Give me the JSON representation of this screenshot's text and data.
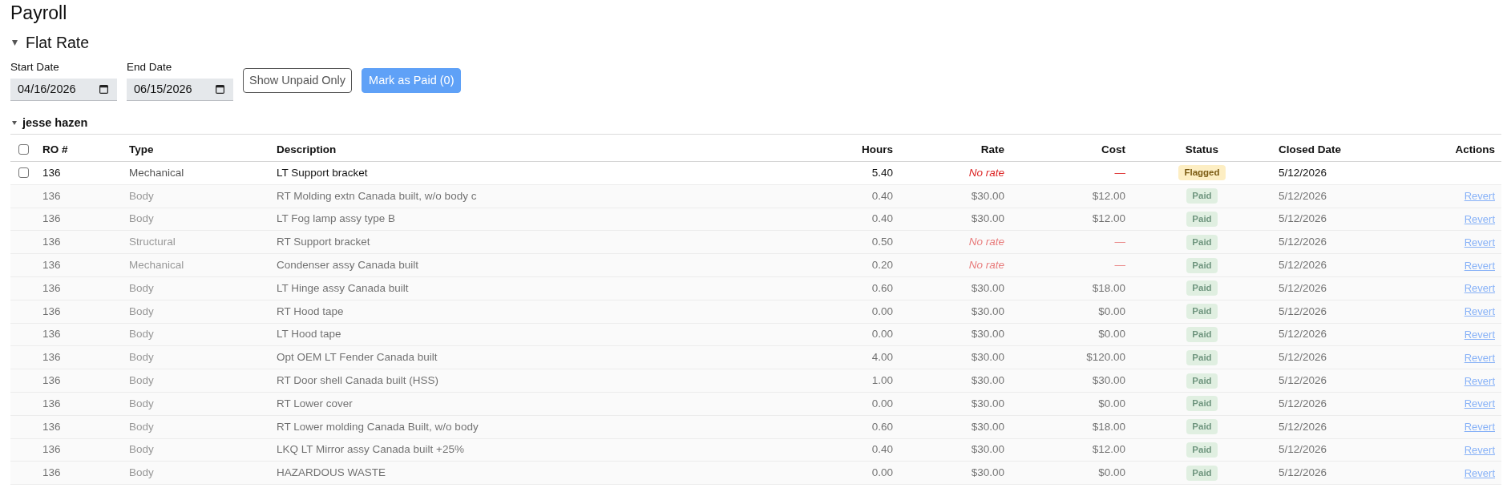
{
  "page": {
    "title": "Payroll"
  },
  "section": {
    "title": "Flat Rate",
    "expanded": true,
    "filters": [
      {
        "label": "Start Date",
        "value": "04/16/2026"
      },
      {
        "label": "End Date",
        "value": "06/15/2026"
      }
    ],
    "buttons": [
      {
        "label": "Show Unpaid Only",
        "kind": "outline"
      },
      {
        "label": "Mark as Paid (0)",
        "kind": "primary"
      }
    ],
    "groups": [
      {
        "name": "jesse hazen",
        "expanded": true,
        "table": {
          "select_all": {
            "checked": false
          },
          "columns": [
            "RO #",
            "Type",
            "Description",
            "Hours",
            "Rate",
            "Cost",
            "Status",
            "Closed Date",
            "Actions"
          ],
          "rows": [
            {
              "kind": "unpaid",
              "checked": false,
              "ro": "136",
              "type": "Mechanical",
              "description": "LT Support bracket",
              "hours": "5.40",
              "rate": "No rate",
              "rate_missing": true,
              "cost": "—",
              "status": {
                "label": "Flagged",
                "kind": "flagged"
              },
              "closed_date": "5/12/2026"
            },
            {
              "kind": "paid",
              "ro": "136",
              "type": "Body",
              "description": "RT Molding extn Canada built, w/o body c",
              "hours": "0.40",
              "rate": "$30.00",
              "rate_missing": false,
              "cost": "$12.00",
              "status": {
                "label": "Paid",
                "kind": "paid"
              },
              "closed_date": "5/12/2026",
              "action": "Revert"
            },
            {
              "kind": "paid",
              "ro": "136",
              "type": "Body",
              "description": "LT Fog lamp assy type B",
              "hours": "0.40",
              "rate": "$30.00",
              "rate_missing": false,
              "cost": "$12.00",
              "status": {
                "label": "Paid",
                "kind": "paid"
              },
              "closed_date": "5/12/2026",
              "action": "Revert"
            },
            {
              "kind": "paid",
              "ro": "136",
              "type": "Structural",
              "description": "RT Support bracket",
              "hours": "0.50",
              "rate": "No rate",
              "rate_missing": true,
              "cost": "—",
              "status": {
                "label": "Paid",
                "kind": "paid"
              },
              "closed_date": "5/12/2026",
              "action": "Revert"
            },
            {
              "kind": "paid",
              "ro": "136",
              "type": "Mechanical",
              "description": "Condenser assy Canada built",
              "hours": "0.20",
              "rate": "No rate",
              "rate_missing": true,
              "cost": "—",
              "status": {
                "label": "Paid",
                "kind": "paid"
              },
              "closed_date": "5/12/2026",
              "action": "Revert"
            },
            {
              "kind": "paid",
              "ro": "136",
              "type": "Body",
              "description": "LT Hinge assy Canada built",
              "hours": "0.60",
              "rate": "$30.00",
              "rate_missing": false,
              "cost": "$18.00",
              "status": {
                "label": "Paid",
                "kind": "paid"
              },
              "closed_date": "5/12/2026",
              "action": "Revert"
            },
            {
              "kind": "paid",
              "ro": "136",
              "type": "Body",
              "description": "RT Hood tape",
              "hours": "0.00",
              "rate": "$30.00",
              "rate_missing": false,
              "cost": "$0.00",
              "status": {
                "label": "Paid",
                "kind": "paid"
              },
              "closed_date": "5/12/2026",
              "action": "Revert"
            },
            {
              "kind": "paid",
              "ro": "136",
              "type": "Body",
              "description": "LT Hood tape",
              "hours": "0.00",
              "rate": "$30.00",
              "rate_missing": false,
              "cost": "$0.00",
              "status": {
                "label": "Paid",
                "kind": "paid"
              },
              "closed_date": "5/12/2026",
              "action": "Revert"
            },
            {
              "kind": "paid",
              "ro": "136",
              "type": "Body",
              "description": "Opt OEM LT Fender Canada built",
              "hours": "4.00",
              "rate": "$30.00",
              "rate_missing": false,
              "cost": "$120.00",
              "status": {
                "label": "Paid",
                "kind": "paid"
              },
              "closed_date": "5/12/2026",
              "action": "Revert"
            },
            {
              "kind": "paid",
              "ro": "136",
              "type": "Body",
              "description": "RT Door shell Canada built (HSS)",
              "hours": "1.00",
              "rate": "$30.00",
              "rate_missing": false,
              "cost": "$30.00",
              "status": {
                "label": "Paid",
                "kind": "paid"
              },
              "closed_date": "5/12/2026",
              "action": "Revert"
            },
            {
              "kind": "paid",
              "ro": "136",
              "type": "Body",
              "description": "RT Lower cover",
              "hours": "0.00",
              "rate": "$30.00",
              "rate_missing": false,
              "cost": "$0.00",
              "status": {
                "label": "Paid",
                "kind": "paid"
              },
              "closed_date": "5/12/2026",
              "action": "Revert"
            },
            {
              "kind": "paid",
              "ro": "136",
              "type": "Body",
              "description": "RT Lower molding Canada Built, w/o body",
              "hours": "0.60",
              "rate": "$30.00",
              "rate_missing": false,
              "cost": "$18.00",
              "status": {
                "label": "Paid",
                "kind": "paid"
              },
              "closed_date": "5/12/2026",
              "action": "Revert"
            },
            {
              "kind": "paid",
              "ro": "136",
              "type": "Body",
              "description": "LKQ LT Mirror assy Canada built +25%",
              "hours": "0.40",
              "rate": "$30.00",
              "rate_missing": false,
              "cost": "$12.00",
              "status": {
                "label": "Paid",
                "kind": "paid"
              },
              "closed_date": "5/12/2026",
              "action": "Revert"
            },
            {
              "kind": "paid",
              "ro": "136",
              "type": "Body",
              "description": "HAZARDOUS WASTE",
              "hours": "0.00",
              "rate": "$30.00",
              "rate_missing": false,
              "cost": "$0.00",
              "status": {
                "label": "Paid",
                "kind": "paid"
              },
              "closed_date": "5/12/2026",
              "action": "Revert"
            }
          ]
        }
      }
    ]
  }
}
